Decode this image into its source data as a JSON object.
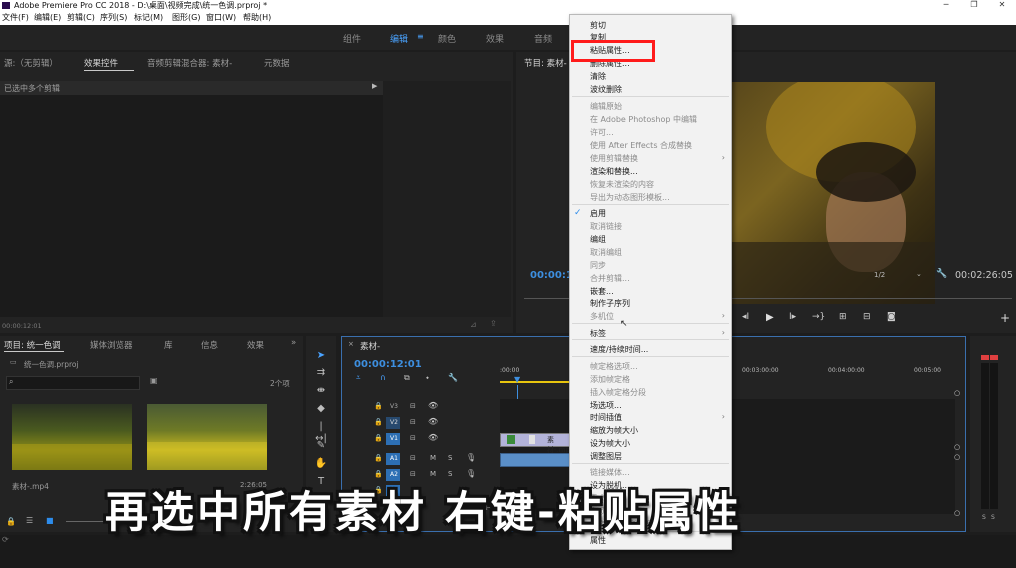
{
  "title_bar": {
    "text": "Adobe Premiere Pro CC 2018 - D:\\桌面\\视频完成\\统一色调.prproj *"
  },
  "menu": [
    "文件(F)",
    "编辑(E)",
    "剪辑(C)",
    "序列(S)",
    "标记(M)",
    "图形(G)",
    "窗口(W)",
    "帮助(H)"
  ],
  "workspaces": [
    "组件",
    "编辑",
    "颜色",
    "效果",
    "音频"
  ],
  "source_panel": {
    "tabs": [
      "源:（无剪辑）",
      "效果控件",
      "音频剪辑混合器: 素材-",
      "元数据"
    ],
    "row_label": "已选中多个剪辑",
    "timecode": "00:00:12:01"
  },
  "program_panel": {
    "title": "节目: 素材-",
    "timecode_left": "00:00:12",
    "zoom": "1/2",
    "timecode_right": "00:02:26:05"
  },
  "project_panel": {
    "tabs": [
      "项目: 统一色调",
      "媒体浏览器",
      "库",
      "信息",
      "效果"
    ],
    "file": "统一色调.prproj",
    "item_count": "2个项",
    "items": [
      {
        "name": "素材-.mp4",
        "duration": ""
      },
      {
        "name": "",
        "duration": "2:26:05"
      }
    ]
  },
  "timeline": {
    "tab": "素材-",
    "timecode": "00:00:12:01",
    "ruler": [
      ":00:00",
      "00:03:00:00",
      "00:04:00:00",
      "00:05:00"
    ],
    "tracks": [
      "V3",
      "V2",
      "V1",
      "A1",
      "A2",
      "A3"
    ],
    "clip_label": "素材-.mp4"
  },
  "context_menu": {
    "items": [
      {
        "label": "剪切",
        "enabled": true
      },
      {
        "label": "复制",
        "enabled": true
      },
      {
        "label": "粘贴属性...",
        "enabled": true
      },
      {
        "label": "删除属性...",
        "enabled": true
      },
      {
        "label": "清除",
        "enabled": true
      },
      {
        "label": "波纹删除",
        "enabled": true
      },
      {
        "label": "编辑原始",
        "enabled": false
      },
      {
        "label": "在 Adobe Photoshop 中编辑",
        "enabled": false
      },
      {
        "label": "许可...",
        "enabled": false
      },
      {
        "label": "使用 After Effects 合成替换",
        "enabled": false
      },
      {
        "label": "使用剪辑替换",
        "enabled": false
      },
      {
        "label": "渲染和替换...",
        "enabled": true
      },
      {
        "label": "恢复未渲染的内容",
        "enabled": false
      },
      {
        "label": "导出为动态图形模板...",
        "enabled": false
      },
      {
        "label": "启用",
        "enabled": true
      },
      {
        "label": "取消链接",
        "enabled": false
      },
      {
        "label": "编组",
        "enabled": true
      },
      {
        "label": "取消编组",
        "enabled": false
      },
      {
        "label": "同步",
        "enabled": false
      },
      {
        "label": "合并剪辑...",
        "enabled": false
      },
      {
        "label": "嵌套...",
        "enabled": true
      },
      {
        "label": "制作子序列",
        "enabled": true
      },
      {
        "label": "多机位",
        "enabled": false
      },
      {
        "label": "标签",
        "enabled": true
      },
      {
        "label": "速度/持续时间...",
        "enabled": true
      },
      {
        "label": "帧定格选项...",
        "enabled": false
      },
      {
        "label": "添加帧定格",
        "enabled": false
      },
      {
        "label": "插入帧定格分段",
        "enabled": false
      },
      {
        "label": "场选项...",
        "enabled": true
      },
      {
        "label": "时间插值",
        "enabled": true
      },
      {
        "label": "缩放为帧大小",
        "enabled": true
      },
      {
        "label": "设为帧大小",
        "enabled": true
      },
      {
        "label": "调整图层",
        "enabled": true
      },
      {
        "label": "链接媒体...",
        "enabled": false
      },
      {
        "label": "设为脱机...",
        "enabled": true
      },
      {
        "label": "重命名...",
        "enabled": false
      },
      {
        "label": "在项目中显示",
        "enabled": false
      },
      {
        "label": "在资源管理器中显示...",
        "enabled": false
      },
      {
        "label": "属性",
        "enabled": true
      }
    ]
  },
  "caption": "再选中所有素材 右键-粘贴属性",
  "colors": {
    "accent": "#2d8ceb",
    "highlight": "#ff1b1b"
  }
}
